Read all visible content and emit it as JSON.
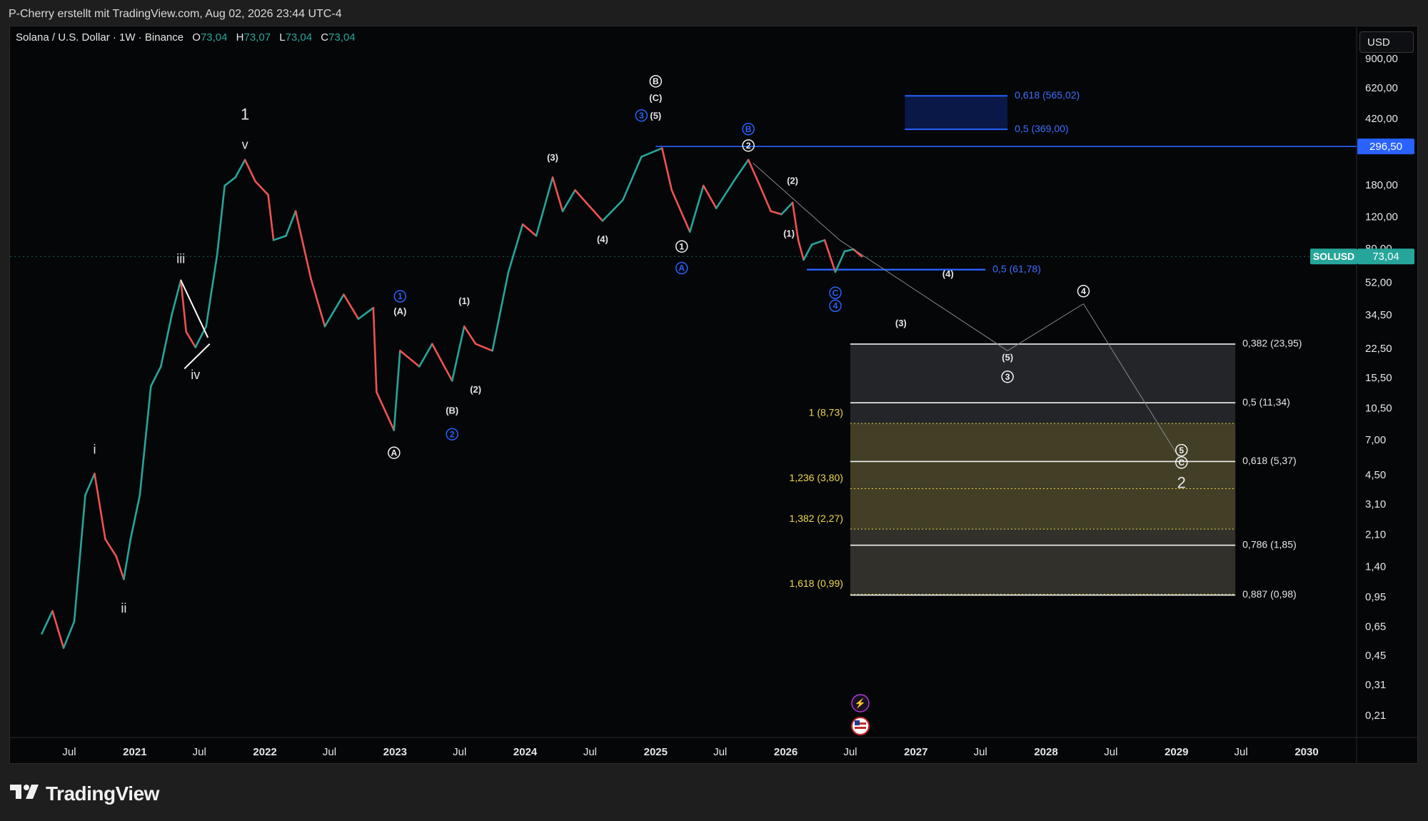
{
  "header": {
    "attribution": "P-Cherry erstellt mit TradingView.com, Aug 02, 2026 23:44 UTC-4"
  },
  "legend": {
    "symbol": "Solana / U.S. Dollar · 1W · Binance",
    "o_label": "O",
    "o_value": "73,04",
    "h_label": "H",
    "h_value": "73,07",
    "l_label": "L",
    "l_value": "73,04",
    "c_label": "C",
    "c_value": "73,04"
  },
  "currency_button": "USD",
  "brand": "TradingView",
  "colors": {
    "background": "#050608",
    "up": "#26a69a",
    "down": "#ef5350",
    "blue": "#2962ff",
    "fib_yellow": "#f0d84b",
    "current_price_green": "#26a69a"
  },
  "chart_data": {
    "type": "line",
    "scale": "log",
    "x_axis": {
      "type": "date",
      "tick_labels": [
        "Jul",
        "2021",
        "Jul",
        "2022",
        "Jul",
        "2023",
        "Jul",
        "2024",
        "Jul",
        "2025",
        "Jul",
        "2026",
        "Jul",
        "2027",
        "Jul",
        "2028",
        "Jul",
        "2029",
        "Jul",
        "2030"
      ],
      "tick_dates": [
        "2020-07",
        "2021-01",
        "2021-07",
        "2022-01",
        "2022-07",
        "2023-01",
        "2023-07",
        "2024-01",
        "2024-07",
        "2025-01",
        "2025-07",
        "2026-01",
        "2026-07",
        "2027-01",
        "2027-07",
        "2028-01",
        "2028-07",
        "2029-01",
        "2029-07",
        "2030-01"
      ]
    },
    "y_axis": {
      "scale": "log",
      "range": [
        0.17,
        1050
      ],
      "tick_labels": [
        "900,00",
        "620,00",
        "420,00",
        "180,00",
        "120,00",
        "80,00",
        "52,00",
        "34,50",
        "22,50",
        "15,50",
        "10,50",
        "7,00",
        "4,50",
        "3,10",
        "2,10",
        "1,40",
        "0,95",
        "0,65",
        "0,45",
        "0,31",
        "0,21"
      ],
      "tick_values": [
        900,
        620,
        420,
        180,
        120,
        80,
        52,
        34.5,
        22.5,
        15.5,
        10.5,
        7,
        4.5,
        3.1,
        2.1,
        1.4,
        0.95,
        0.65,
        0.45,
        0.31,
        0.21
      ]
    },
    "series": [
      {
        "name": "SOLUSD",
        "points": [
          [
            "2020-04-15",
            0.6
          ],
          [
            "2020-05-15",
            0.8
          ],
          [
            "2020-06-15",
            0.5
          ],
          [
            "2020-07-15",
            0.7
          ],
          [
            "2020-08-15",
            3.5
          ],
          [
            "2020-09-10",
            4.6
          ],
          [
            "2020-10-10",
            2.0
          ],
          [
            "2020-11-10",
            1.6
          ],
          [
            "2020-12-01",
            1.2
          ],
          [
            "2020-12-20",
            2.0
          ],
          [
            "2021-01-15",
            3.5
          ],
          [
            "2021-02-15",
            14.0
          ],
          [
            "2021-03-15",
            18.0
          ],
          [
            "2021-04-15",
            35.0
          ],
          [
            "2021-05-10",
            54.0
          ],
          [
            "2021-05-25",
            28.0
          ],
          [
            "2021-06-20",
            23.0
          ],
          [
            "2021-07-20",
            30.0
          ],
          [
            "2021-08-20",
            75.0
          ],
          [
            "2021-09-10",
            180.0
          ],
          [
            "2021-10-10",
            200.0
          ],
          [
            "2021-11-06",
            250.0
          ],
          [
            "2021-12-05",
            190.0
          ],
          [
            "2022-01-10",
            160.0
          ],
          [
            "2022-01-25",
            90.0
          ],
          [
            "2022-03-01",
            95.0
          ],
          [
            "2022-03-28",
            130.0
          ],
          [
            "2022-05-10",
            55.0
          ],
          [
            "2022-06-18",
            30.0
          ],
          [
            "2022-08-10",
            45.0
          ],
          [
            "2022-09-20",
            33.0
          ],
          [
            "2022-11-01",
            38.0
          ],
          [
            "2022-11-10",
            13.0
          ],
          [
            "2022-12-29",
            8.0
          ],
          [
            "2023-01-15",
            22.0
          ],
          [
            "2023-03-10",
            18.0
          ],
          [
            "2023-04-15",
            24.0
          ],
          [
            "2023-06-10",
            15.0
          ],
          [
            "2023-07-14",
            30.0
          ],
          [
            "2023-08-15",
            24.0
          ],
          [
            "2023-10-01",
            22.0
          ],
          [
            "2023-11-15",
            60.0
          ],
          [
            "2023-12-25",
            110.0
          ],
          [
            "2024-02-01",
            95.0
          ],
          [
            "2024-03-18",
            200.0
          ],
          [
            "2024-04-15",
            130.0
          ],
          [
            "2024-05-20",
            170.0
          ],
          [
            "2024-08-05",
            115.0
          ],
          [
            "2024-10-01",
            150.0
          ],
          [
            "2024-11-22",
            260.0
          ],
          [
            "2025-01-19",
            290.0
          ],
          [
            "2025-02-15",
            170.0
          ],
          [
            "2025-04-07",
            100.0
          ],
          [
            "2025-05-15",
            180.0
          ],
          [
            "2025-06-20",
            135.0
          ],
          [
            "2025-08-15",
            200.0
          ],
          [
            "2025-09-18",
            250.0
          ],
          [
            "2025-10-15",
            190.0
          ],
          [
            "2025-11-20",
            130.0
          ],
          [
            "2025-12-20",
            125.0
          ],
          [
            "2026-01-20",
            145.0
          ],
          [
            "2026-02-05",
            90.0
          ],
          [
            "2026-02-20",
            70.0
          ],
          [
            "2026-03-15",
            85.0
          ],
          [
            "2026-04-20",
            90.0
          ],
          [
            "2026-05-20",
            60.0
          ],
          [
            "2026-06-15",
            78.0
          ],
          [
            "2026-07-10",
            80.0
          ],
          [
            "2026-08-02",
            73.04
          ]
        ]
      }
    ],
    "projection_path": [
      [
        "2025-10-01",
        240.0
      ],
      [
        "2026-06-01",
        90.0
      ],
      [
        "2027-09-15",
        22.0
      ],
      [
        "2028-04-15",
        40.0
      ],
      [
        "2029-01-15",
        5.37
      ]
    ],
    "horizontal_lines": [
      {
        "label": "296,50",
        "value": 296.5,
        "start": "2025-01-01"
      },
      {
        "label": "",
        "value": 61.78,
        "start": "2026-03-01",
        "end": "2027-07-15"
      }
    ],
    "current_price": {
      "symbol": "SOLUSD",
      "value": "73,04"
    },
    "fib_target_box": {
      "start": "2026-12-01",
      "end": "2027-09-15",
      "levels": [
        {
          "label": "0,618 (565,02)",
          "value": 565.02
        },
        {
          "label": "0,5 (369,00)",
          "value": 369.0
        }
      ],
      "label_point": "5"
    },
    "fib_left_labels": [
      {
        "label": "0,5 (61,78)",
        "value": 61.78
      }
    ],
    "fib_retracement": {
      "start": "2026-07-01",
      "end": "2029-06-15",
      "levels": [
        {
          "label": "0,382 (23,95)",
          "value": 23.95
        },
        {
          "label": "0,5 (11,34)",
          "value": 11.34
        },
        {
          "label": "0,618 (5,37)",
          "value": 5.37
        },
        {
          "label": "0,786 (1,85)",
          "value": 1.85
        },
        {
          "label": "0,887 (0,98)",
          "value": 0.98
        }
      ]
    },
    "fib_extension": {
      "levels": [
        {
          "label": "1 (8,73)",
          "value": 8.73
        },
        {
          "label": "1,236 (3,80)",
          "value": 3.8
        },
        {
          "label": "1,382 (2,27)",
          "value": 2.27
        },
        {
          "label": "1,618 (0,99)",
          "value": 0.99
        }
      ]
    },
    "wave_labels": [
      {
        "text": "i",
        "date": "2020-09-10",
        "value": 6.2,
        "style": "roman"
      },
      {
        "text": "ii",
        "date": "2020-12-01",
        "value": 0.82,
        "style": "roman"
      },
      {
        "text": "iii",
        "date": "2021-05-10",
        "value": 70.0,
        "style": "roman"
      },
      {
        "text": "iv",
        "date": "2021-06-20",
        "value": 16.0,
        "style": "roman"
      },
      {
        "text": "v",
        "date": "2021-11-06",
        "value": 300.0,
        "style": "roman"
      },
      {
        "text": "1",
        "date": "2021-11-06",
        "value": 440.0,
        "style": "big"
      },
      {
        "text": "A",
        "date": "2022-12-29",
        "value": 6.0,
        "style": "circle-white"
      },
      {
        "text": "1",
        "date": "2023-01-15",
        "value": 44.0,
        "style": "circle-blue"
      },
      {
        "text": "(A)",
        "date": "2023-01-15",
        "value": 36.0,
        "style": "paren"
      },
      {
        "text": "(1)",
        "date": "2023-07-14",
        "value": 41.0,
        "style": "paren"
      },
      {
        "text": "(B)",
        "date": "2023-06-10",
        "value": 10.2,
        "style": "paren"
      },
      {
        "text": "2",
        "date": "2023-06-10",
        "value": 7.6,
        "style": "circle-blue"
      },
      {
        "text": "(2)",
        "date": "2023-08-15",
        "value": 13.3,
        "style": "paren"
      },
      {
        "text": "(3)",
        "date": "2024-03-18",
        "value": 255.0,
        "style": "paren"
      },
      {
        "text": "(4)",
        "date": "2024-08-05",
        "value": 90.0,
        "style": "paren"
      },
      {
        "text": "3",
        "date": "2024-11-22",
        "value": 440.0,
        "style": "circle-blue"
      },
      {
        "text": "B",
        "date": "2025-01-01",
        "value": 680.0,
        "style": "circle-white"
      },
      {
        "text": "(C)",
        "date": "2025-01-01",
        "value": 545.0,
        "style": "paren"
      },
      {
        "text": "(5)",
        "date": "2025-01-01",
        "value": 435.0,
        "style": "paren"
      },
      {
        "text": "1",
        "date": "2025-03-15",
        "value": 83.0,
        "style": "circle-white"
      },
      {
        "text": "A",
        "date": "2025-03-15",
        "value": 63.0,
        "style": "circle-blue"
      },
      {
        "text": "B",
        "date": "2025-09-18",
        "value": 370.0,
        "style": "circle-blue"
      },
      {
        "text": "2",
        "date": "2025-09-18",
        "value": 300.0,
        "style": "circle-white"
      },
      {
        "text": "(2)",
        "date": "2026-01-20",
        "value": 190.0,
        "style": "paren"
      },
      {
        "text": "(1)",
        "date": "2026-01-10",
        "value": 97.0,
        "style": "paren"
      },
      {
        "text": "C",
        "date": "2026-05-20",
        "value": 46.0,
        "style": "circle-blue"
      },
      {
        "text": "4",
        "date": "2026-05-20",
        "value": 39.0,
        "style": "circle-blue"
      },
      {
        "text": "(4)",
        "date": "2027-04-01",
        "value": 58.0,
        "style": "paren"
      },
      {
        "text": "(3)",
        "date": "2026-11-20",
        "value": 31.0,
        "style": "paren"
      },
      {
        "text": "(5)",
        "date": "2027-09-15",
        "value": 20.0,
        "style": "paren"
      },
      {
        "text": "3",
        "date": "2027-09-15",
        "value": 15.8,
        "style": "circle-white"
      },
      {
        "text": "4",
        "date": "2028-04-15",
        "value": 47.0,
        "style": "circle-white"
      },
      {
        "text": "5",
        "date": "2029-01-15",
        "value": 6.2,
        "style": "circle-white"
      },
      {
        "text": "C",
        "date": "2029-01-15",
        "value": 5.3,
        "style": "circle-white"
      },
      {
        "text": "2",
        "date": "2029-01-15",
        "value": 4.05,
        "style": "big"
      }
    ]
  }
}
